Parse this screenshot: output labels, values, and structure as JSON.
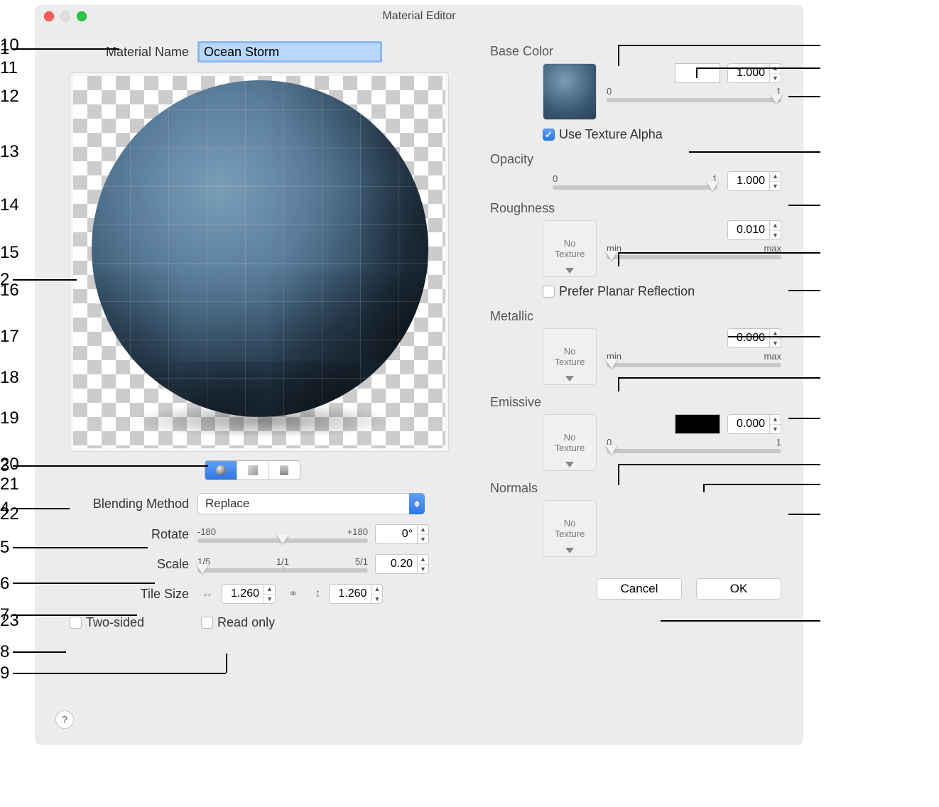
{
  "window": {
    "title": "Material Editor"
  },
  "left": {
    "material_name_label": "Material Name",
    "material_name_value": "Ocean Storm",
    "blending_label": "Blending Method",
    "blending_value": "Replace",
    "rotate_label": "Rotate",
    "rotate_value": "0°",
    "rotate_min": "-180",
    "rotate_max": "+180",
    "scale_label": "Scale",
    "scale_value": "0.20",
    "scale_min": "1/5",
    "scale_mid": "1/1",
    "scale_max": "5/1",
    "tile_label": "Tile Size",
    "tile_x": "1.260",
    "tile_y": "1.260",
    "two_sided": "Two-sided",
    "read_only": "Read only"
  },
  "right": {
    "base_color_label": "Base Color",
    "base_color_value": "1.000",
    "base_color_min": "0",
    "base_color_max": "1",
    "use_texture_alpha": "Use Texture Alpha",
    "opacity_label": "Opacity",
    "opacity_value": "1.000",
    "opacity_min": "0",
    "opacity_max": "1",
    "roughness_label": "Roughness",
    "roughness_value": "0.010",
    "roughness_min": "min",
    "roughness_max": "max",
    "no_texture": "No\nTexture",
    "no_tex_line1": "No",
    "no_tex_line2": "Texture",
    "prefer_planar": "Prefer Planar Reflection",
    "metallic_label": "Metallic",
    "metallic_value": "0.000",
    "metallic_min": "min",
    "metallic_max": "max",
    "emissive_label": "Emissive",
    "emissive_value": "0.000",
    "emissive_min": "0",
    "emissive_max": "1",
    "normals_label": "Normals",
    "cancel": "Cancel",
    "ok": "OK"
  },
  "callouts": [
    "1",
    "2",
    "3",
    "4",
    "5",
    "6",
    "7",
    "8",
    "9",
    "10",
    "11",
    "12",
    "13",
    "14",
    "15",
    "16",
    "17",
    "18",
    "19",
    "20",
    "21",
    "22",
    "23"
  ]
}
